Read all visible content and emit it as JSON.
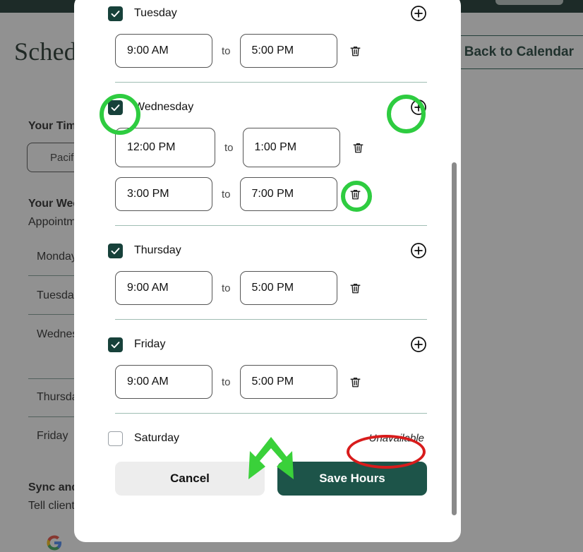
{
  "background": {
    "page_title": "Schedule",
    "back_button": "Back to Calendar",
    "timezone_label": "Your Time Zone",
    "timezone_value": "Pacific",
    "weekly_heading": "Your Weekly Hours",
    "weekly_sub": "Appointments",
    "day_rows": [
      "Monday",
      "Tuesday",
      "Wednesday",
      "Thursday",
      "Friday"
    ],
    "sync_heading": "Sync and Calendar",
    "sync_sub": "Tell clients",
    "google_icon": "google-logo-icon"
  },
  "modal": {
    "days": [
      {
        "name": "Tuesday",
        "checked": true,
        "available": true,
        "add_icon": "plus-circle-icon",
        "slots": [
          {
            "start": "9:00 AM",
            "end": "5:00 PM",
            "to": "to",
            "delete_icon": "trash-icon"
          }
        ]
      },
      {
        "name": "Wednesday",
        "checked": true,
        "available": true,
        "add_icon": "plus-circle-icon",
        "slots": [
          {
            "start": "12:00 PM",
            "end": "1:00 PM",
            "to": "to",
            "delete_icon": "trash-icon"
          },
          {
            "start": "3:00 PM",
            "end": "7:00 PM",
            "to": "to",
            "delete_icon": "trash-icon"
          }
        ]
      },
      {
        "name": "Thursday",
        "checked": true,
        "available": true,
        "add_icon": "plus-circle-icon",
        "slots": [
          {
            "start": "9:00 AM",
            "end": "5:00 PM",
            "to": "to",
            "delete_icon": "trash-icon"
          }
        ]
      },
      {
        "name": "Friday",
        "checked": true,
        "available": true,
        "add_icon": "plus-circle-icon",
        "slots": [
          {
            "start": "9:00 AM",
            "end": "5:00 PM",
            "to": "to",
            "delete_icon": "trash-icon"
          }
        ]
      },
      {
        "name": "Saturday",
        "checked": false,
        "available": false,
        "unavailable_label": "Unavailable",
        "slots": []
      }
    ],
    "cancel_label": "Cancel",
    "save_label": "Save Hours"
  },
  "annotations": {
    "highlight_color": "#2ecc40",
    "ellipse_color": "#d81c1c",
    "arrow_icon": "double-arrow-down-split-icon",
    "items": [
      "wednesday-checkbox-highlight",
      "wednesday-add-slot-highlight",
      "wednesday-second-slot-delete-highlight",
      "saturday-unavailable-ellipse"
    ]
  },
  "colors": {
    "brand_dark": "#17413a",
    "save_button": "#1d5449",
    "topbar": "#0d2b24",
    "divider": "#9fbdb3"
  }
}
